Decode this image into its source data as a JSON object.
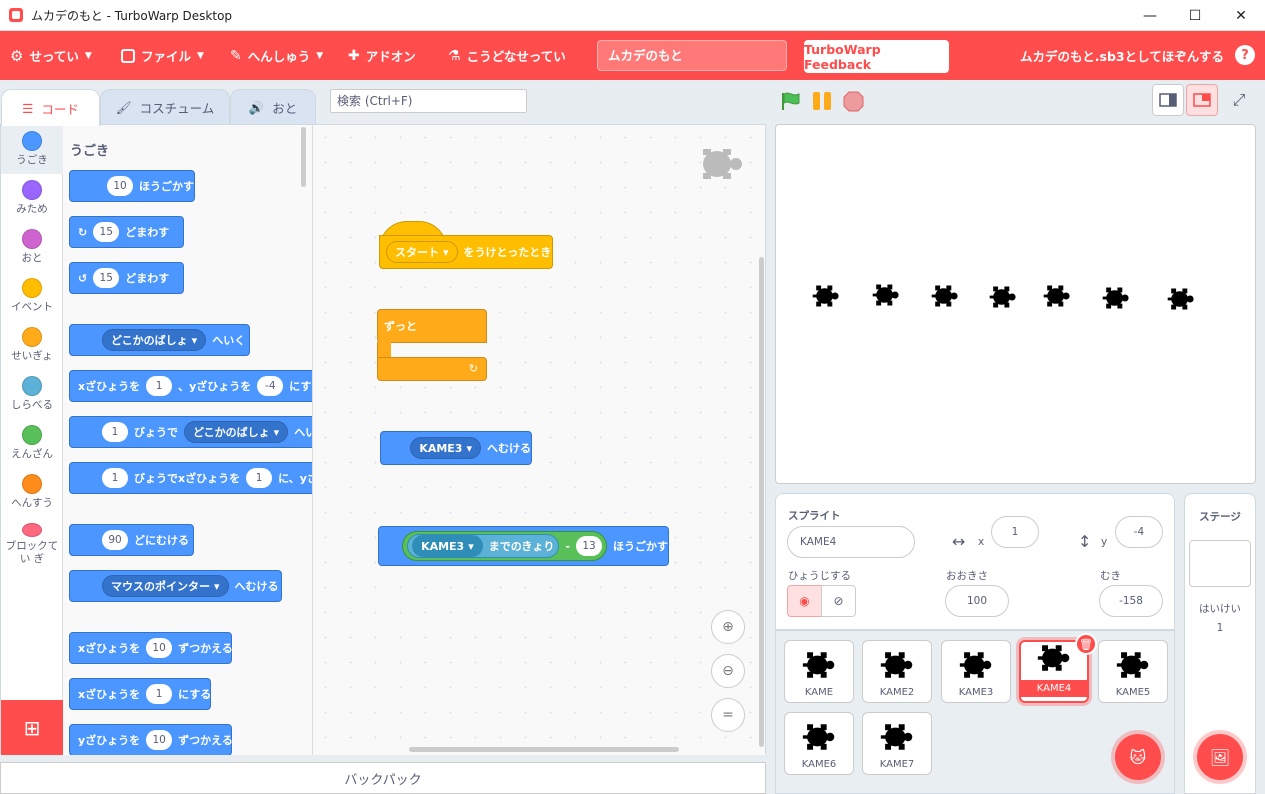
{
  "window": {
    "title": "ムカデのもと - TurboWarp Desktop"
  },
  "menu": {
    "settings": "せってい",
    "file": "ファイル",
    "edit": "へんしゅう",
    "addons": "アドオン",
    "howto": "こうどなせってい",
    "project_title": "ムカデのもと",
    "feedback": "TurboWarp Feedback",
    "save": "ムカデのもと.sb3としてほぞんする",
    "help": "?"
  },
  "tabs": {
    "code": "コード",
    "costume": "コスチューム",
    "sound": "おと"
  },
  "search": {
    "placeholder": "検索 (Ctrl+F)"
  },
  "categories": [
    {
      "label": "うごき",
      "color": "#4c97ff"
    },
    {
      "label": "みため",
      "color": "#9966ff"
    },
    {
      "label": "おと",
      "color": "#cf63cf"
    },
    {
      "label": "イベント",
      "color": "#ffbf00"
    },
    {
      "label": "せいぎょ",
      "color": "#ffab19"
    },
    {
      "label": "しらべる",
      "color": "#5cb1d6"
    },
    {
      "label": "えんざん",
      "color": "#59c059"
    },
    {
      "label": "へんすう",
      "color": "#ff8c1a"
    },
    {
      "label": "ブロックてい ぎ",
      "color": "#ff6680"
    }
  ],
  "palette": {
    "heading": "うごき",
    "move": {
      "n": "10",
      "t": "ほうごかす"
    },
    "turn_right": {
      "n": "15",
      "t": "どまわす"
    },
    "turn_left": {
      "n": "15",
      "t": "どまわす"
    },
    "goto": {
      "dd": "どこかのばしょ",
      "t": "へいく"
    },
    "gotoxy": {
      "a": "xざひょうを",
      "x": "1",
      "b": "、yざひょうを",
      "y": "-4",
      "c": "にする"
    },
    "glide": {
      "n": "1",
      "a": "びょうで",
      "dd": "どこかのばしょ",
      "b": "へい"
    },
    "glidexy": {
      "n": "1",
      "a": "びょうでxざひょうを",
      "x": "1",
      "b": "に、yざ"
    },
    "point": {
      "n": "90",
      "t": "どにむける"
    },
    "pointto": {
      "dd": "マウスのポインター",
      "t": "へむける"
    },
    "changex": {
      "a": "xざひょうを",
      "n": "10",
      "b": "ずつかえる"
    },
    "setx": {
      "a": "xざひょうを",
      "n": "1",
      "b": "にする"
    },
    "changey": {
      "a": "yざひょうを",
      "n": "10",
      "b": "ずつかえる"
    }
  },
  "script": {
    "hat": {
      "dd": "スタート",
      "t": "をうけとったとき"
    },
    "forever": "ずっと",
    "pointto": {
      "dd": "KAME3",
      "t": "へむける"
    },
    "move": {
      "dd": "KAME3",
      "a": "までのきょり",
      "op": "-",
      "n": "13",
      "t": "ほうごかす"
    }
  },
  "sprite": {
    "label": "スプライト",
    "name": "KAME4",
    "x_label": "x",
    "x": "1",
    "y_label": "y",
    "y": "-4",
    "show_label": "ひょうじする",
    "size_label": "おおきさ",
    "size": "100",
    "dir_label": "むき",
    "direction": "-158"
  },
  "sprites": [
    "KAME",
    "KAME2",
    "KAME3",
    "KAME4",
    "KAME5",
    "KAME6",
    "KAME7"
  ],
  "stage_panel": {
    "title": "ステージ",
    "backdrops_label": "はいけい",
    "backdrops": "1"
  },
  "backpack": "バックパック"
}
